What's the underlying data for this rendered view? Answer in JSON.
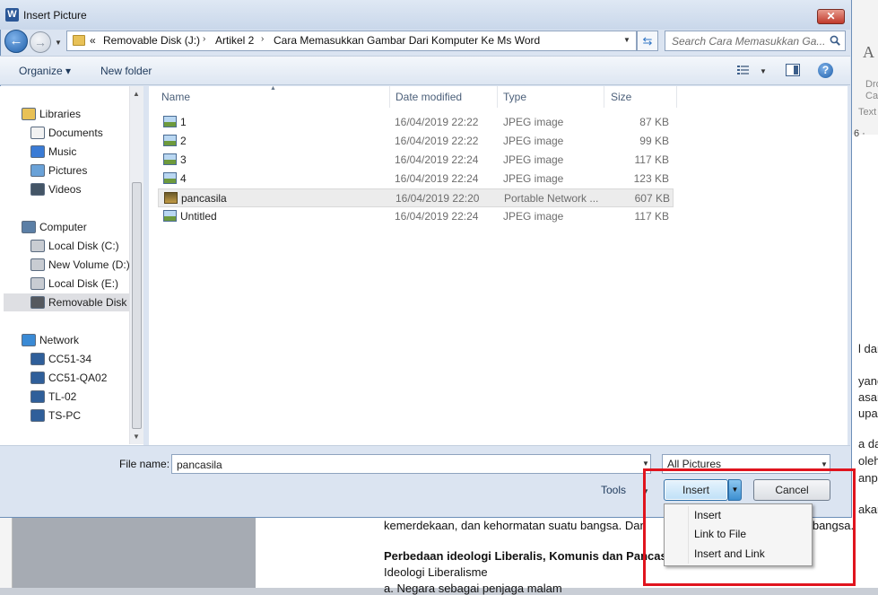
{
  "dialog": {
    "title": "Insert Picture",
    "app_icon_letter": "W",
    "close_glyph": "✕"
  },
  "address": {
    "overflow": "«",
    "crumbs": [
      "Removable Disk (J:)",
      "Artikel 2",
      "Cara Memasukkan Gambar Dari Komputer Ke Ms Word"
    ],
    "separator": "›"
  },
  "search": {
    "placeholder": "Search Cara Memasukkan Ga..."
  },
  "toolbar": {
    "organize": "Organize ▾",
    "new_folder": "New folder",
    "help_glyph": "?"
  },
  "navpane": {
    "groups": [
      {
        "label": "Libraries",
        "icon": "libraries-icon",
        "items": [
          {
            "label": "Documents",
            "icon": "documents-icon"
          },
          {
            "label": "Music",
            "icon": "music-icon"
          },
          {
            "label": "Pictures",
            "icon": "pictures-icon"
          },
          {
            "label": "Videos",
            "icon": "videos-icon"
          }
        ]
      },
      {
        "label": "Computer",
        "icon": "computer-icon",
        "items": [
          {
            "label": "Local Disk (C:)",
            "icon": "drive-icon"
          },
          {
            "label": "New Volume (D:)",
            "icon": "drive-icon"
          },
          {
            "label": "Local Disk (E:)",
            "icon": "drive-icon"
          },
          {
            "label": "Removable Disk (",
            "icon": "usb-drive-icon",
            "selected": true
          }
        ]
      },
      {
        "label": "Network",
        "icon": "network-icon",
        "items": [
          {
            "label": "CC51-34",
            "icon": "network-pc-icon"
          },
          {
            "label": "CC51-QA02",
            "icon": "network-pc-icon"
          },
          {
            "label": "TL-02",
            "icon": "network-pc-icon"
          },
          {
            "label": "TS-PC",
            "icon": "network-pc-icon"
          }
        ]
      }
    ]
  },
  "filelist": {
    "columns": [
      "Name",
      "Date modified",
      "Type",
      "Size"
    ],
    "rows": [
      {
        "name": "1",
        "date": "16/04/2019 22:22",
        "type": "JPEG image",
        "size": "87 KB"
      },
      {
        "name": "2",
        "date": "16/04/2019 22:22",
        "type": "JPEG image",
        "size": "99 KB"
      },
      {
        "name": "3",
        "date": "16/04/2019 22:24",
        "type": "JPEG image",
        "size": "117 KB"
      },
      {
        "name": "4",
        "date": "16/04/2019 22:24",
        "type": "JPEG image",
        "size": "123 KB"
      },
      {
        "name": "pancasila",
        "date": "16/04/2019 22:20",
        "type": "Portable Network ...",
        "size": "607 KB",
        "selected": true
      },
      {
        "name": "Untitled",
        "date": "16/04/2019 22:24",
        "type": "JPEG image",
        "size": "117 KB"
      }
    ]
  },
  "bottom": {
    "file_name_label": "File name:",
    "file_name_value": "pancasila",
    "filter": "All Pictures",
    "tools": "Tools",
    "insert": "Insert",
    "cancel": "Cancel"
  },
  "insert_menu": [
    "Insert",
    "Link to File",
    "Insert and Link"
  ],
  "ribbon": {
    "glyph": "A",
    "dro": "Dro",
    "cap": "Cap",
    "text": "Text",
    "ruler": "6 ·"
  },
  "document": {
    "fragments": [
      "l dan",
      "yang",
      "asan,",
      "upar",
      "a dan",
      "oleh",
      "anpa",
      "akar"
    ],
    "line1": "kemerdekaan, dan kehormatan suatu bangsa. Dan",
    "line1_tail": "u bangsa.",
    "heading": "Perbedaan ideologi Liberalis, Komunis dan Pancasi",
    "subheading": "Ideologi Liberalisme",
    "partial": "a.    Negara sebagai penjaga malam"
  },
  "colors": {
    "highlight_box": "#e0141e",
    "accent": "#2f6fa8"
  }
}
